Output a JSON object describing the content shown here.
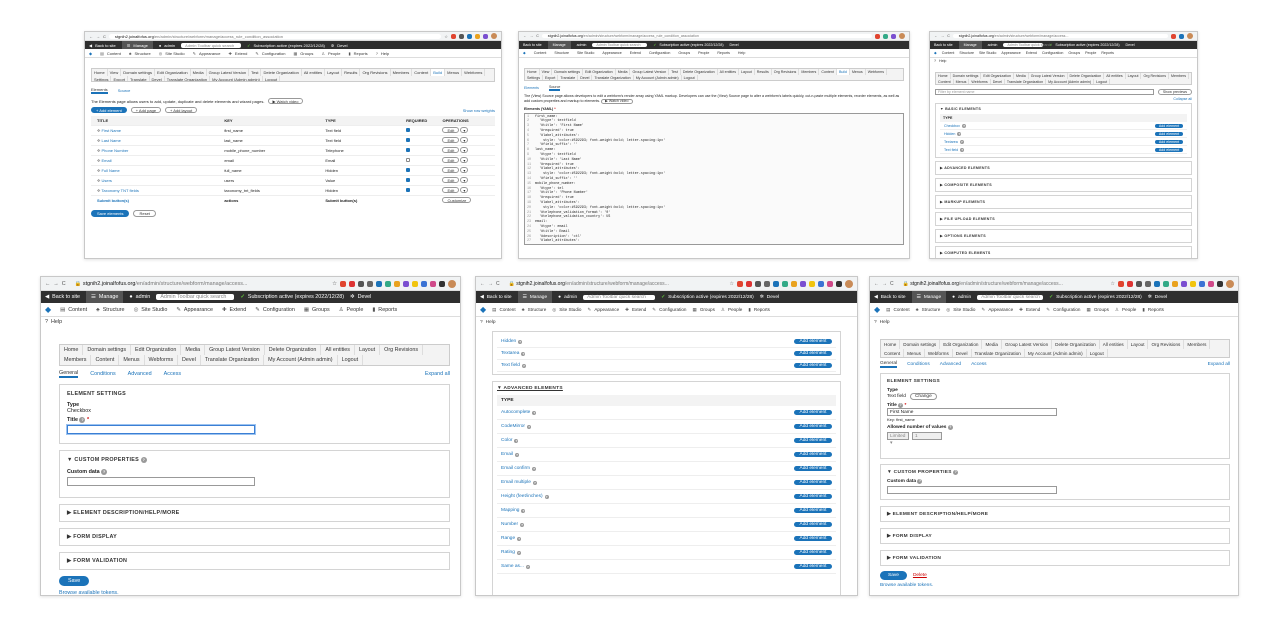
{
  "browser": {
    "back": "←",
    "forward": "→",
    "reload": "C",
    "url_host": "stgnih2.joinalfofus.org",
    "url_rest_1": "/en/admin/structure/webform/manage/access_rule_condition_association",
    "url_rest_2": "/en/admin/structure/webform/manage/access_rule_condition_association",
    "url_rest_3": "/en/admin/structure/webform/manage/access...",
    "url_rest_4": "/en/admin/structure/webform/manage/access...",
    "url_rest_5": "/en/admin/structure/webform/manage/access...",
    "url_rest_6": "/en/admin/structure/webform/manage/access...",
    "star": "☆",
    "ext_colors": [
      "#e0442f",
      "#d33",
      "#555",
      "#666",
      "#1b73b9",
      "#3a8",
      "#e9a21f",
      "#7a4fd0",
      "#f1c40f",
      "#3b73d4",
      "#d04a8a",
      "#333"
    ]
  },
  "toolbar": {
    "back_to_site": "Back to site",
    "manage": "Manage",
    "user": "admin",
    "quick_search_placeholder": "Admin Toolbar quick search",
    "subscription": "Subscription active (expires 2022/12/28)",
    "devel": "Devel"
  },
  "menu": {
    "content": "Content",
    "structure": "Structure",
    "site_studio": "Site Studio",
    "appearance": "Appearance",
    "extend": "Extend",
    "configuration": "Configuration",
    "groups": "Groups",
    "people": "People",
    "reports": "Reports",
    "help": "Help"
  },
  "tabs": {
    "large": [
      "Home",
      "Domain settings",
      "Edit Organization",
      "Media",
      "Group Latest Version",
      "Delete Organization",
      "All entities",
      "Layout",
      "Org Revisions",
      "Members",
      "Content",
      "Menus",
      "Webforms",
      "Devel",
      "Translate Organization",
      "My Account (Admin admin)",
      "Logout"
    ],
    "p1": [
      "Home",
      "View",
      "Domain settings",
      "Edit Organization",
      "Media",
      "Group Latest Version",
      "Test",
      "Delete Organization",
      "All entities",
      "Layout",
      "Results",
      "Org Revisions",
      "Members",
      "Content",
      "Build",
      "Menus",
      "Webforms",
      "Settings",
      "Export",
      "Translate",
      "Devel",
      "Translate Organization",
      "My Account (Admin admin)",
      "Logout"
    ],
    "p1_active": "Build"
  },
  "p1": {
    "subtabs": [
      "Elements",
      "Source"
    ],
    "description": "The Elements page allows users to add, update, duplicate and delete elements and wizard pages.",
    "watch_video": "▶ Watch video",
    "add_element": "+ Add element",
    "add_page": "+ Add page",
    "add_layout": "+ Add layout",
    "show_row_weights": "Show row weights",
    "columns": [
      "TITLE",
      "KEY",
      "TYPE",
      "REQUIRED",
      "OPERATIONS"
    ],
    "rows": [
      {
        "title": "First Name",
        "key": "first_name",
        "type": "Text field",
        "req": true
      },
      {
        "title": "Last Name",
        "key": "last_name",
        "type": "Text field",
        "req": true
      },
      {
        "title": "Phone Number",
        "key": "mobile_phone_number",
        "type": "Telephone",
        "req": true
      },
      {
        "title": "Email",
        "key": "email",
        "type": "Email",
        "req": false
      },
      {
        "title": "Full Name",
        "key": "full_name",
        "type": "Hidden",
        "req": true
      },
      {
        "title": "Users",
        "key": "users",
        "type": "Value",
        "req": true
      },
      {
        "title": "Taxonomy TNT fields",
        "key": "taxonomy_tnt_fields",
        "type": "Hidden",
        "req": true
      }
    ],
    "edit": "Edit",
    "submit_row": {
      "title": "Submit button(s)",
      "key": "actions",
      "type": "Submit button(s)",
      "op": "Customize"
    },
    "save_elements": "Save elements",
    "reset": "Reset"
  },
  "p2": {
    "subtabs": [
      "Elements",
      "Source"
    ],
    "description": "The (View) Source page allows developers to edit a webform's render array using YAML markup. Developers can use the (View) Source page to alter a webform's labels quickly, cut-n-paste multiple elements, reorder elements, as well as add custom properties and markup to elements.",
    "watch_video": "▶ Watch video",
    "label": "Elements (YAML)",
    "code": [
      "first_name:",
      "  '#type': textfield",
      "  '#title': 'First Name'",
      "  '#required': true",
      "  '#label_attributes':",
      "    style: 'color:#592293; font-weight:bold; letter-spacing:1px'",
      "  '#field_suffix': ''",
      "last_name:",
      "  '#type': textfield",
      "  '#title': 'Last Name'",
      "  '#required': true",
      "  '#label_attributes':",
      "    style: 'color:#592293; font-weight:bold; letter-spacing:1px'",
      "  '#field_suffix': ''",
      "mobile_phone_number:",
      "  '#type': tel",
      "  '#title': 'Phone Number'",
      "  '#required': true",
      "  '#label_attributes':",
      "    style: 'color:#592293; font-weight:bold; letter-spacing:1px'",
      "  '#telephone_validation_format': '0'",
      "  '#telephone_validation_country': US",
      "email:",
      "  '#type': email",
      "  '#title': Email",
      "  '#description': 'ctl'",
      "  '#label_attributes':"
    ]
  },
  "p3": {
    "filter_placeholder": "Filter by element name",
    "show_previews": "Show previews",
    "collapse_all": "Collapse all",
    "basic": "BASIC ELEMENTS",
    "type_col": "TYPE",
    "basic_items": [
      "Checkbox",
      "Hidden",
      "Textarea",
      "Text field"
    ],
    "add_element": "Add element",
    "sections": [
      "ADVANCED ELEMENTS",
      "COMPOSITE ELEMENTS",
      "MARKUP ELEMENTS",
      "FILE UPLOAD ELEMENTS",
      "OPTIONS ELEMENTS",
      "COMPUTED ELEMENTS"
    ]
  },
  "p4": {
    "subtabs": [
      "General",
      "Conditions",
      "Advanced",
      "Access"
    ],
    "expand_all": "Expand all",
    "element_settings": "ELEMENT SETTINGS",
    "type_label": "Type",
    "type_value": "Checkbox",
    "title_label": "Title",
    "custom_properties": "▼ CUSTOM PROPERTIES",
    "custom_data": "Custom data",
    "collapsed": [
      "▶ ELEMENT DESCRIPTION/HELP/MORE",
      "▶ FORM DISPLAY",
      "▶ FORM VALIDATION"
    ],
    "save": "Save",
    "browse_tokens": "Browse available tokens."
  },
  "p5": {
    "basic_items": [
      "Hidden",
      "Textarea",
      "Text field"
    ],
    "advanced": "▼ ADVANCED ELEMENTS",
    "type_col": "TYPE",
    "advanced_items": [
      "Autocomplete",
      "CodeMirror",
      "Color",
      "Email",
      "Email confirm",
      "Email multiple",
      "Height (feet/inches)",
      "Mapping",
      "Number",
      "Range",
      "Rating",
      "Same as..."
    ],
    "add_element": "Add element"
  },
  "p6": {
    "subtabs": [
      "General",
      "Conditions",
      "Advanced",
      "Access"
    ],
    "expand_all": "Expand all",
    "element_settings": "ELEMENT SETTINGS",
    "type_label": "Type",
    "type_value": "Text field",
    "change": "Change",
    "title_label": "Title",
    "title_value": "First Name",
    "key_label": "Key: first_name",
    "allowed_label": "Allowed number of values",
    "limited": "Limited",
    "limited_num": "1",
    "custom_properties": "▼ CUSTOM PROPERTIES",
    "custom_data": "Custom data",
    "collapsed": [
      "▶ ELEMENT DESCRIPTION/HELP/MORE",
      "▶ FORM DISPLAY",
      "▶ FORM VALIDATION"
    ],
    "save": "Save",
    "delete": "Delete",
    "browse_tokens": "Browse available tokens."
  }
}
